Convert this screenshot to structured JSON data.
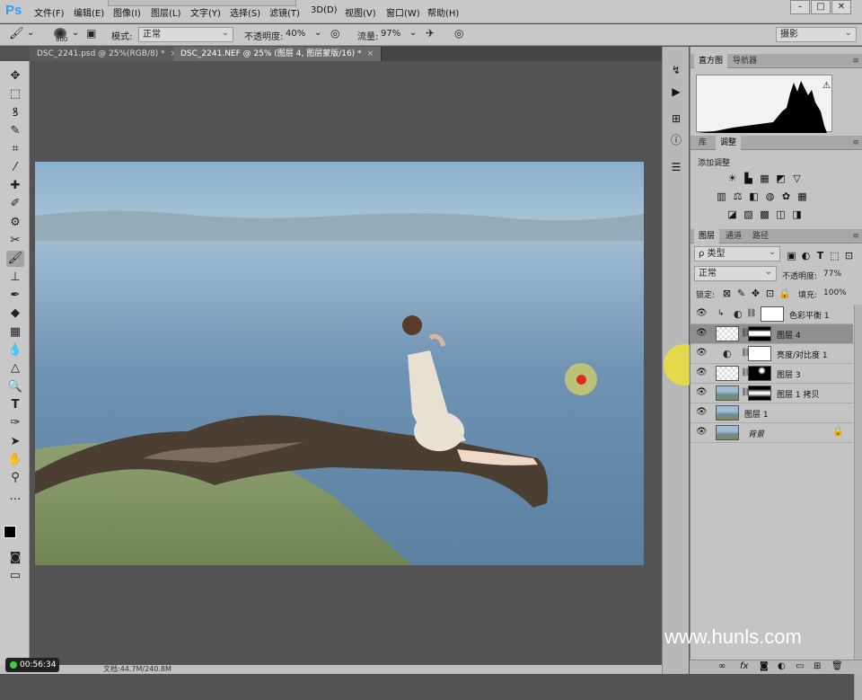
{
  "app": {
    "logo": "Ps"
  },
  "menu": [
    "文件(F)",
    "编辑(E)",
    "图像(I)",
    "图层(L)",
    "文字(Y)",
    "选择(S)",
    "滤镜(T)",
    "3D(D)",
    "视图(V)",
    "窗口(W)",
    "帮助(H)"
  ],
  "window_controls": {
    "min": "–",
    "max": "□",
    "close": "✕"
  },
  "options": {
    "brush_size": "800",
    "mode_label": "模式:",
    "mode_value": "正常",
    "opacity_label": "不透明度:",
    "opacity_value": "40%",
    "flow_label": "流量:",
    "flow_value": "97%",
    "workspace": "摄影"
  },
  "tabs": [
    {
      "label": "DSC_2241.psd @ 25%(RGB/8) *",
      "close": "×"
    },
    {
      "label": "DSC_2241.NEF @ 25% (图层 4, 图层蒙版/16) *",
      "close": "×"
    }
  ],
  "panels": {
    "top_tabs": [
      "直方图",
      "导航器"
    ],
    "adj_tabs": [
      "库",
      "调整"
    ],
    "adj_title": "添加调整",
    "layers_tabs": [
      "图层",
      "通道",
      "路径"
    ],
    "filter_kind": "ρ 类型",
    "blend_mode": "正常",
    "opacity_label": "不透明度:",
    "opacity_value": "77%",
    "lock_label": "锁定:",
    "fill_label": "填充:",
    "fill_value": "100%",
    "layers": [
      {
        "name": "色彩平衡 1"
      },
      {
        "name": "图层 4"
      },
      {
        "name": "亮度/对比度 1"
      },
      {
        "name": "图层 3"
      },
      {
        "name": "图层 1 拷贝"
      },
      {
        "name": "图层 1"
      },
      {
        "name": "背景"
      }
    ]
  },
  "status": {
    "doc": "文档:44.7M/240.8M"
  },
  "timer": "00:56:34",
  "watermark": "www.hunls.com",
  "colors": {
    "accent": "#2ea3f2",
    "ui_bg": "#c8c8c8",
    "canvas_bg": "#535353"
  }
}
